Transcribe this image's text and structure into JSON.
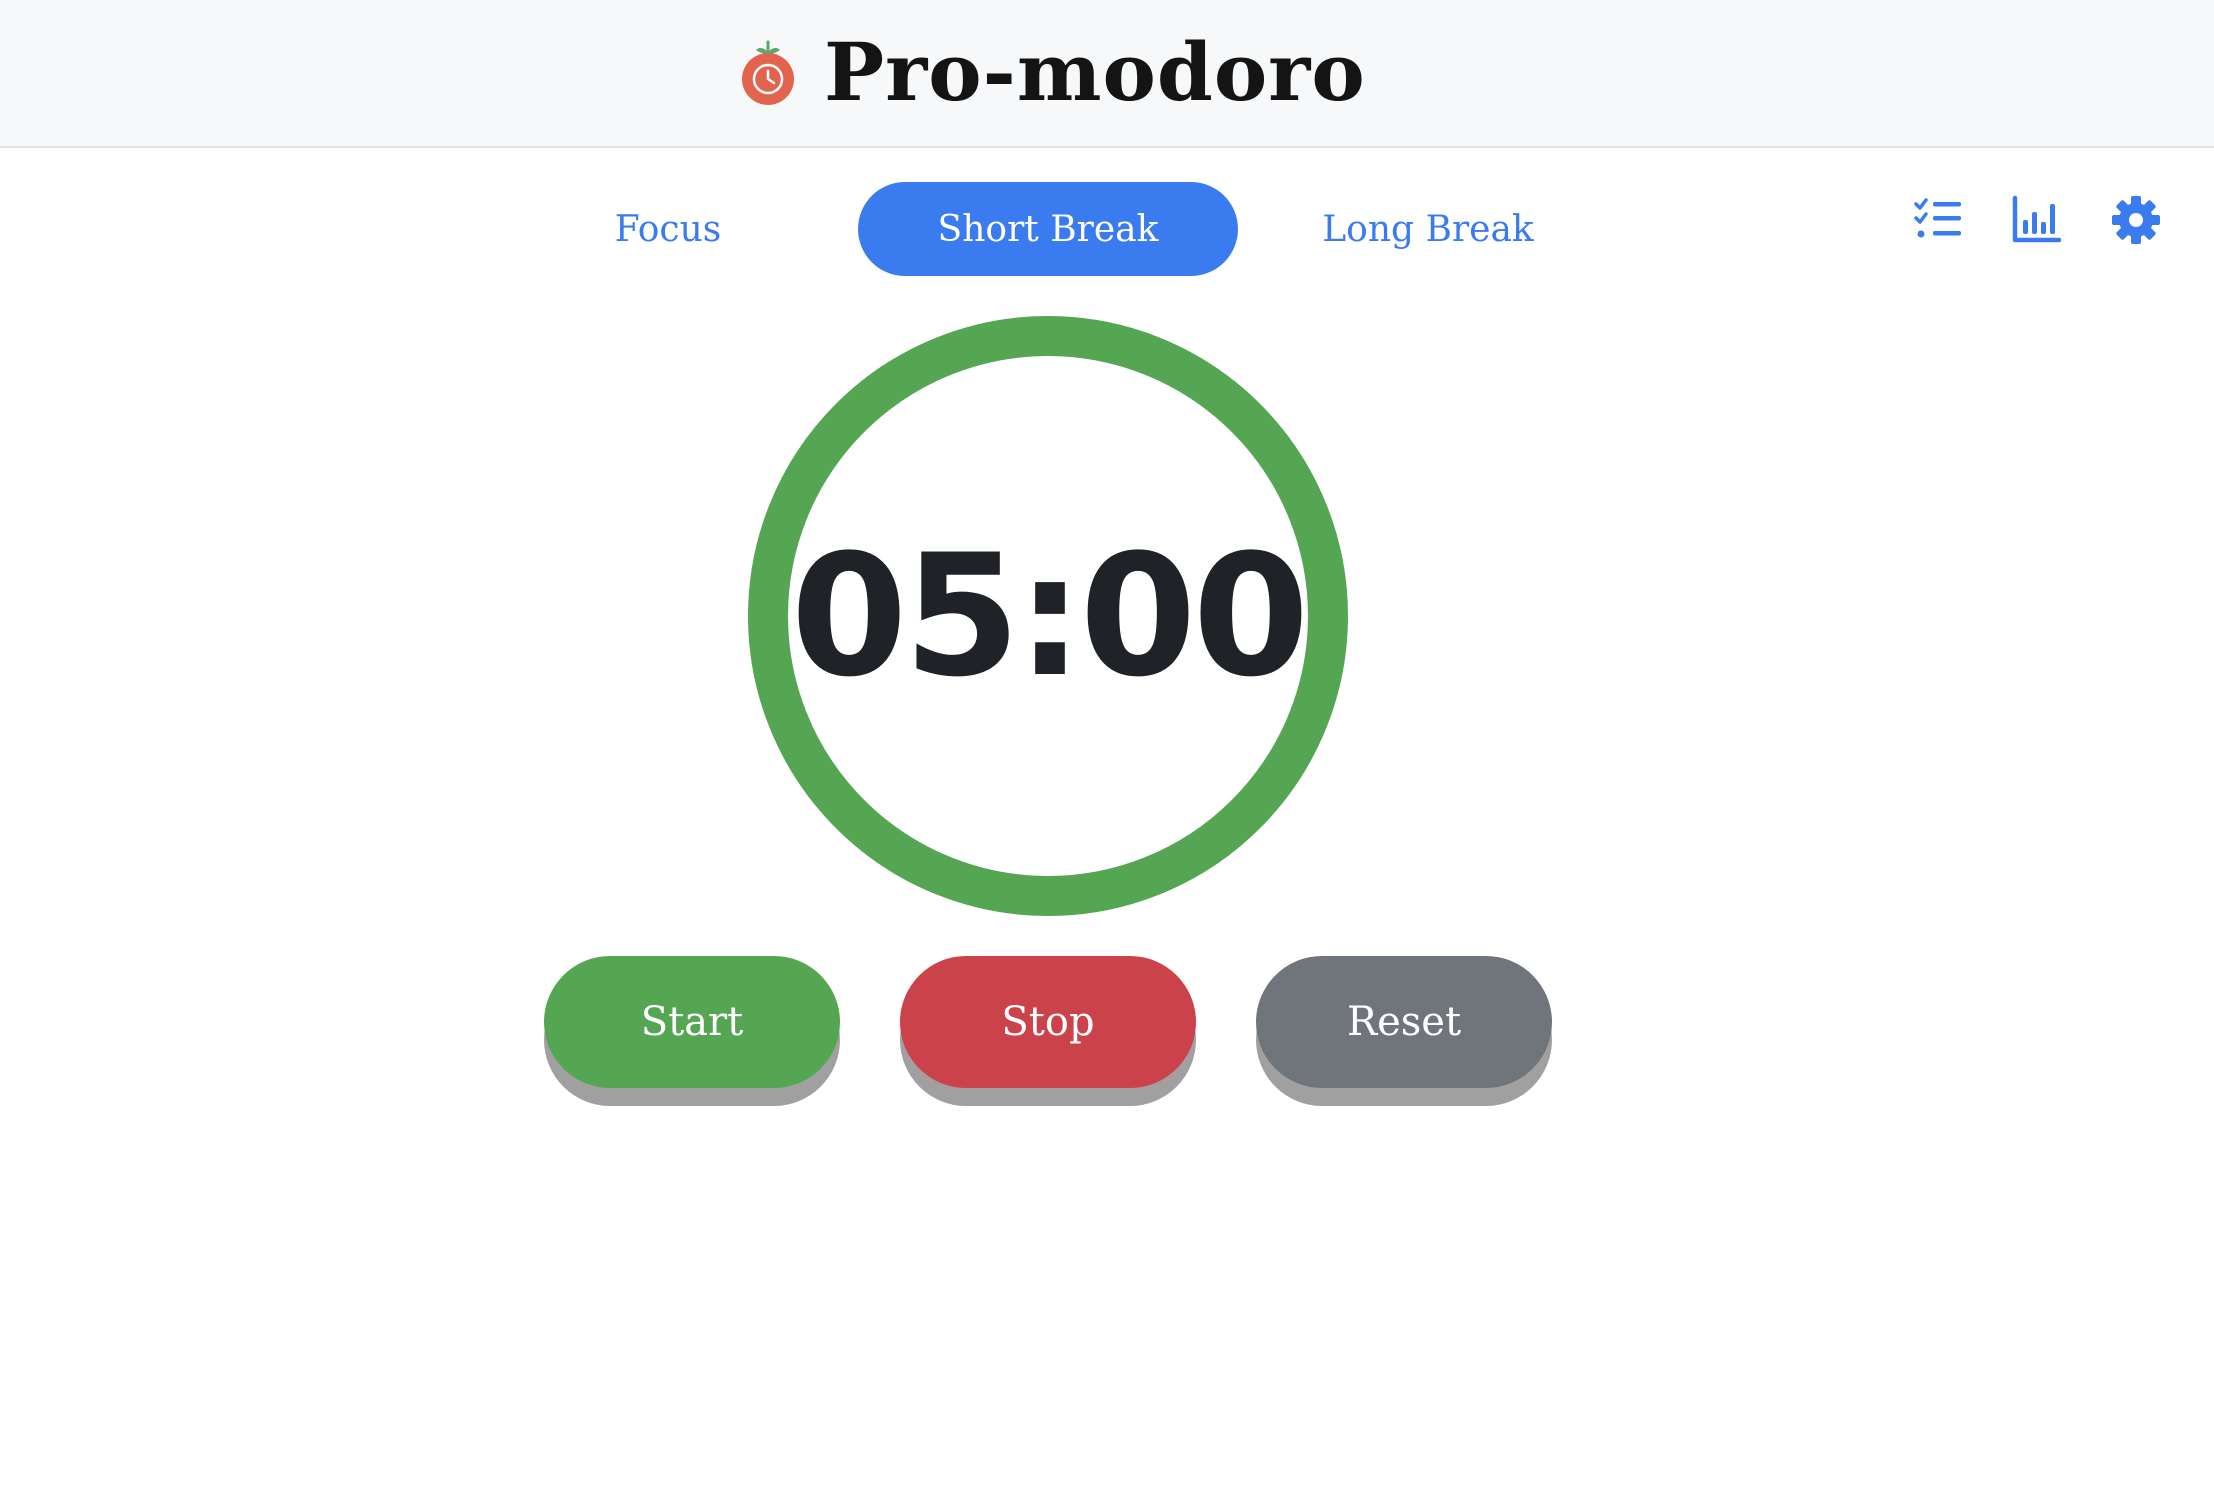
{
  "app": {
    "title": "Pro-modoro"
  },
  "tabs": [
    {
      "label": "Focus",
      "active": false
    },
    {
      "label": "Short Break",
      "active": true
    },
    {
      "label": "Long Break",
      "active": false
    }
  ],
  "toolbar": {
    "icons": [
      "tasks-list-icon",
      "stats-chart-icon",
      "settings-gear-icon"
    ]
  },
  "timer": {
    "display": "05:00",
    "progress": 1.0
  },
  "controls": {
    "start_label": "Start",
    "stop_label": "Stop",
    "reset_label": "Reset"
  },
  "colors": {
    "accent": "#3b7bf0",
    "ring": "#55a652",
    "start": "#55a652",
    "stop": "#cc424b",
    "reset": "#70757c"
  }
}
